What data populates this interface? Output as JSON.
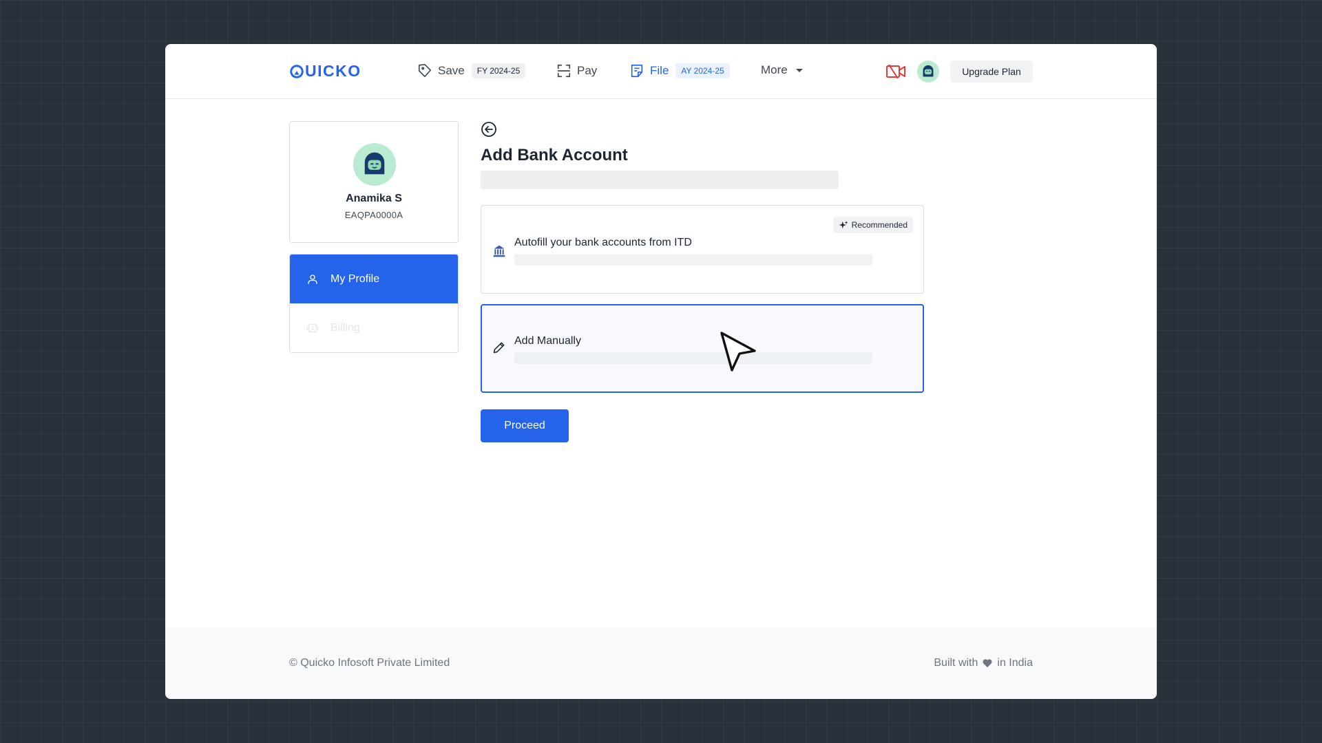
{
  "brand": {
    "logo_text": "UICKO"
  },
  "nav": {
    "save": {
      "label": "Save",
      "pill": "FY 2024-25"
    },
    "pay": {
      "label": "Pay"
    },
    "file": {
      "label": "File",
      "pill": "AY 2024-25"
    },
    "more": {
      "label": "More"
    },
    "upgrade_label": "Upgrade Plan"
  },
  "profile": {
    "name": "Anamika S",
    "pan": "EAQPA0000A"
  },
  "sidebar": {
    "items": [
      {
        "label": "My Profile",
        "icon": "user-icon",
        "state": "active"
      },
      {
        "label": "Billing",
        "icon": "billing-icon",
        "state": "disabled"
      }
    ]
  },
  "main": {
    "title": "Add Bank Account",
    "options": [
      {
        "label": "Autofill your bank accounts from ITD",
        "icon": "bank-icon",
        "badge": "Recommended",
        "selected": false
      },
      {
        "label": "Add Manually",
        "icon": "pencil-icon",
        "selected": true
      }
    ],
    "proceed_label": "Proceed"
  },
  "footer": {
    "copyright": "© Quicko Infosoft Private Limited",
    "built_prefix": "Built with",
    "built_suffix": "in India"
  },
  "colors": {
    "brand": "#2563eb",
    "video": "#e53935",
    "avatar_bg": "#b8ebd0"
  }
}
